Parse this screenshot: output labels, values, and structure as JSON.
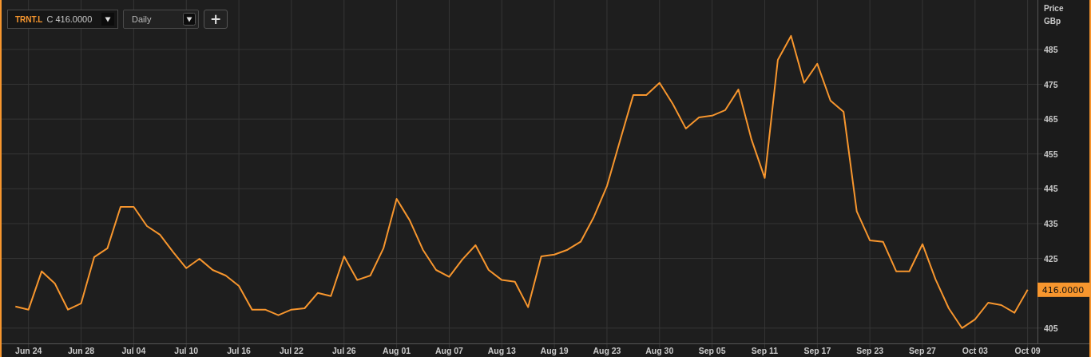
{
  "toolbar": {
    "quote": "C 416.0000",
    "interval": "Daily",
    "add_button": "+"
  },
  "chart": {
    "currency": "GBp",
    "last_price_label": "416.0000",
    "chart_data": {
      "type": "line",
      "ylabel": "Price",
      "categories": [
        null,
        "Jun 24",
        null,
        null,
        null,
        "Jun 28",
        null,
        null,
        null,
        "Jul 04",
        null,
        null,
        null,
        "Jul 10",
        null,
        null,
        null,
        "Jul 16",
        null,
        null,
        null,
        "Jul 22",
        null,
        null,
        null,
        "Jul 26",
        null,
        null,
        null,
        "Aug 01",
        null,
        null,
        null,
        "Aug 07",
        null,
        null,
        null,
        "Aug 13",
        null,
        null,
        null,
        "Aug 19",
        null,
        null,
        null,
        "Aug 23",
        null,
        null,
        null,
        "Aug 30",
        null,
        null,
        null,
        "Sep 05",
        null,
        null,
        null,
        "Sep 11",
        null,
        null,
        null,
        "Sep 17",
        null,
        null,
        null,
        "Sep 23",
        null,
        null,
        null,
        "Sep 27",
        null,
        null,
        null,
        "Oct 03",
        null,
        null,
        null,
        "Oct 09"
      ],
      "series": [
        {
          "name": "TRNT.L",
          "color": "#f7962e",
          "values": [
            411.2,
            410.3,
            421.3,
            417.8,
            410.3,
            412.1,
            425.4,
            427.9,
            439.8,
            439.8,
            434.3,
            431.8,
            426.8,
            422.2,
            424.9,
            421.7,
            420.1,
            417.1,
            410.3,
            410.3,
            408.7,
            410.3,
            410.7,
            415.1,
            414.2,
            425.6,
            418.8,
            420.1,
            427.9,
            442.1,
            435.9,
            427.5,
            421.7,
            419.7,
            424.7,
            428.8,
            421.7,
            418.8,
            418.3,
            411.0,
            425.6,
            426.1,
            427.5,
            429.8,
            436.9,
            445.8,
            458.9,
            471.9,
            471.9,
            475.4,
            469.4,
            462.3,
            465.5,
            466.0,
            467.6,
            473.5,
            459.1,
            448.1,
            482.0,
            488.9,
            475.4,
            480.9,
            470.3,
            467.1,
            438.5,
            430.2,
            429.8,
            421.3,
            421.3,
            429.1,
            419.0,
            410.7,
            405.0,
            407.5,
            412.3,
            411.6,
            409.4,
            416.0
          ]
        }
      ],
      "grid": true,
      "ylim": [
        400.6,
        499.2
      ],
      "yticks": [
        405,
        425,
        435,
        445,
        455,
        465,
        475,
        485
      ]
    }
  }
}
